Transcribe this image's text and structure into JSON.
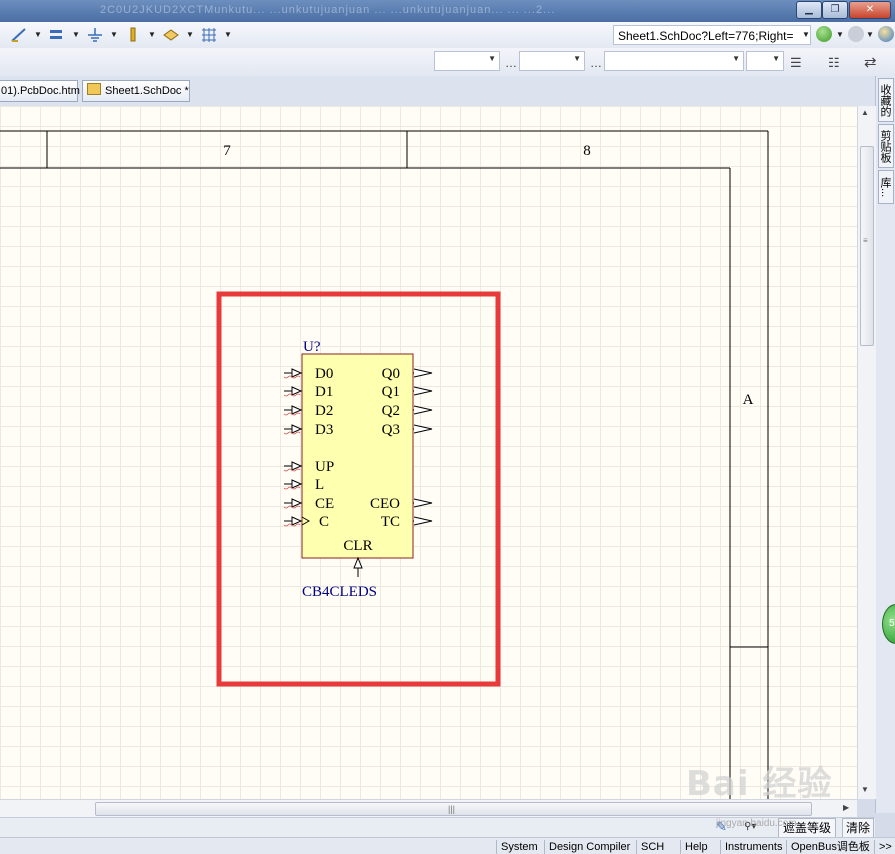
{
  "titlebar": {
    "blurred_text": "2C0U2JKUD2XCTMunkutu... ...unkutujuanjuan ... ...unkutujuanjuan... ... ...2...",
    "buttons": {
      "minimize": "▁",
      "restore": "❐",
      "close": "✕"
    }
  },
  "toolbar": {
    "address_value": "Sheet1.SchDoc?Left=776;Right=",
    "icons": [
      "wire-icon",
      "bus-icon",
      "ground-icon",
      "port-icon",
      "net-label-icon",
      "grid-icon"
    ]
  },
  "tabs": [
    {
      "label": "01).PcbDoc.htm"
    },
    {
      "label": "Sheet1.SchDoc *"
    }
  ],
  "side_panel": {
    "tabs": [
      "收藏的",
      "剪贴板",
      "库..."
    ]
  },
  "sheet": {
    "column_labels": [
      "7",
      "8"
    ],
    "row_label": "A"
  },
  "component": {
    "designator": "U?",
    "comment": "CB4CLEDS",
    "left_pins": [
      "D0",
      "D1",
      "D2",
      "D3",
      "UP",
      "L",
      "CE",
      "C"
    ],
    "right_pins": [
      "Q0",
      "Q1",
      "Q2",
      "Q3",
      "CEO",
      "TC"
    ],
    "bottom_pin": "CLR",
    "body_color": "#ffffb0",
    "text_color": "#000080"
  },
  "highlight": {
    "color": "#e83a3a"
  },
  "filter_bar": {
    "mask_level": "遮盖等级",
    "clear": "清除"
  },
  "status_bar": {
    "items": [
      "System",
      "Design Compiler",
      "SCH",
      "Help",
      "Instruments",
      "OpenBus调色板",
      ">>"
    ]
  },
  "watermark": {
    "text": "Bai 经验",
    "sub": "jingyan.baidu.com"
  },
  "green_badge": {
    "text": "5"
  }
}
